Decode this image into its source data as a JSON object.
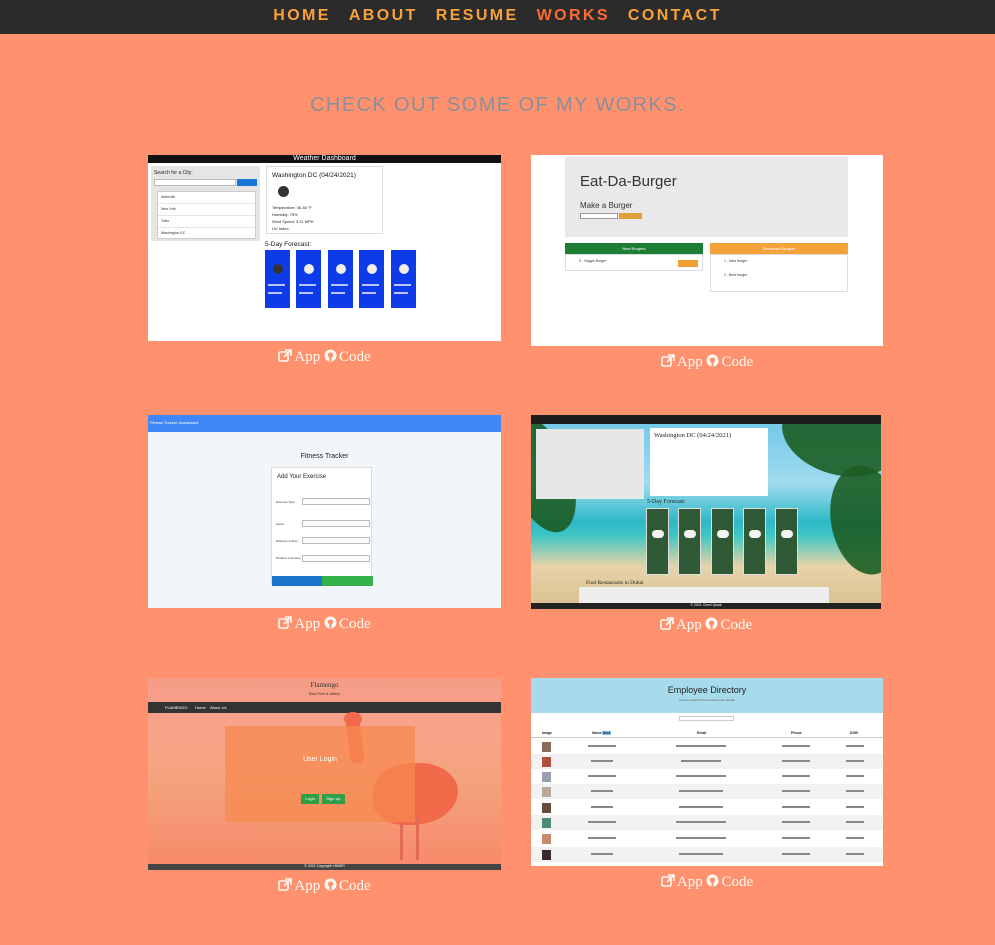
{
  "nav": {
    "items": [
      "HOME",
      "ABOUT",
      "RESUME",
      "WORKS",
      "CONTACT"
    ],
    "active": "WORKS"
  },
  "section_title": "CHECK OUT SOME OF MY WORKS.",
  "link_labels": {
    "app": "App",
    "code": "Code"
  },
  "projects": [
    {
      "shot": {
        "header": "Weather Dashboard",
        "search_label": "Search for a City:",
        "cities": [
          "Abbeville",
          "New York",
          "Tokio",
          "Washington DC"
        ],
        "city_title": "Washington DC (04/24/2021)",
        "stats": [
          "Temperature: 46.38 °F",
          "Humidity: 75%",
          "Wind Speed: 3.11 MPH",
          "UV Index:"
        ],
        "forecast_title": "5-Day Forecast:"
      }
    },
    {
      "shot": {
        "title": "Eat-Da-Burger",
        "subtitle": "Make a Burger",
        "add_button": "Add Burger",
        "new_header": "New Burgers",
        "devoured_header": "Devoured Burgers",
        "new_items": [
          "5 - Veggie Burger"
        ],
        "devour_button": "Devour it!",
        "devoured_items": [
          "1 - New burger",
          "2 - Beef burger"
        ]
      }
    },
    {
      "shot": {
        "header": "Fitness Tracker Dashboard",
        "title": "Fitness Tracker",
        "card_title": "Add Your Exercise",
        "fields": [
          "Exercise Type",
          "Name",
          "Distance (miles)",
          "Duration (minutes)"
        ],
        "complete_button": "Complete",
        "add_button": "Add Exercise"
      }
    },
    {
      "shot": {
        "city_title": "Washington DC (04/24/2021)",
        "forecast_title": "5-Day Forecast:",
        "bottom_title": "Find Restaurants in Dubai",
        "footer": "© 2021 Chevl Qwak"
      }
    },
    {
      "shot": {
        "title": "Flamengo",
        "subtitle": "Best Price & Vallery",
        "nav": [
          "FLAMENGO",
          "Home",
          "About Us"
        ],
        "box_title": "User Login",
        "login_button": "Login",
        "signup_button": "Sign Up",
        "footer": "© 2021 Copyright: HIMER"
      }
    },
    {
      "shot": {
        "title": "Employee Directory",
        "subtitle": "Use the search box to narrow your results",
        "columns": [
          "Image",
          "Name",
          "Email",
          "Phone",
          "DOB"
        ],
        "sort_label": "Sort"
      }
    }
  ],
  "colors": {
    "background": "#ff916e",
    "nav_bg": "#2b2b2b",
    "nav_link": "#f9a13b",
    "nav_active": "#ff6a33",
    "title": "#8a8f9c",
    "link": "#fdfaf4"
  }
}
